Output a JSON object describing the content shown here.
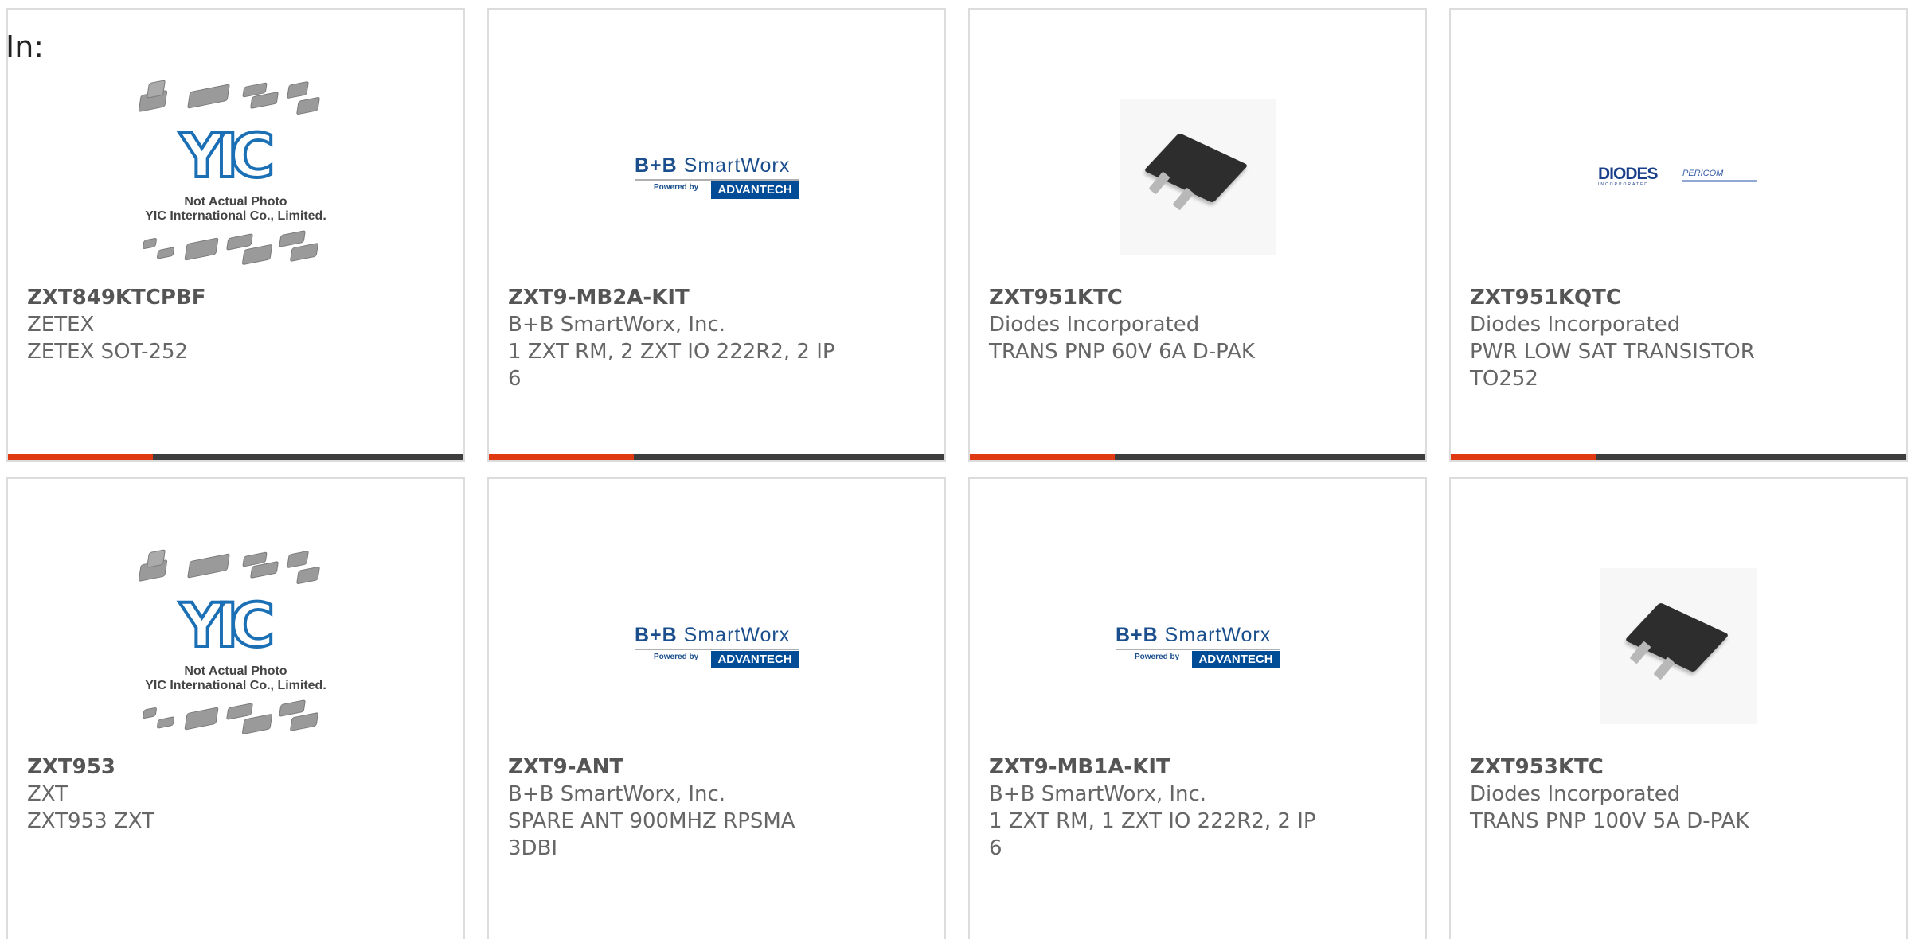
{
  "header": {
    "in_label": "In:"
  },
  "products": [
    {
      "part": "ZXT849KTCPBF",
      "maker": "ZETEX",
      "description": "ZETEX SOT-252",
      "image": "yic-placeholder-image"
    },
    {
      "part": "ZXT9-MB2A-KIT",
      "maker": "B+B SmartWorx, Inc.",
      "description": "1 ZXT RM, 2 ZXT IO 222R2, 2 IP 6",
      "image": "bb-smartworx-logo"
    },
    {
      "part": "ZXT951KTC",
      "maker": "Diodes Incorporated",
      "description": "TRANS PNP 60V 6A D-PAK",
      "image": "transistor-photo"
    },
    {
      "part": "ZXT951KQTC",
      "maker": "Diodes Incorporated",
      "description": "PWR LOW SAT TRANSISTOR TO252",
      "image": "diodes-pericom-logo"
    },
    {
      "part": "ZXT953",
      "maker": "ZXT",
      "description": "ZXT953 ZXT",
      "image": "yic-placeholder-image"
    },
    {
      "part": "ZXT9-ANT",
      "maker": "B+B SmartWorx, Inc.",
      "description": "SPARE ANT 900MHZ RPSMA 3DBI",
      "image": "bb-smartworx-logo"
    },
    {
      "part": "ZXT9-MB1A-KIT",
      "maker": "B+B SmartWorx, Inc.",
      "description": "1 ZXT RM, 1 ZXT IO 222R2, 2 IP 6",
      "image": "bb-smartworx-logo"
    },
    {
      "part": "ZXT953KTC",
      "maker": "Diodes Incorporated",
      "description": "TRANS PNP 100V 5A D-PAK",
      "image": "transistor-photo"
    }
  ],
  "logos": {
    "yic_mark": "YIC",
    "yic_line1": "Not Actual Photo",
    "yic_line2": "YIC International Co., Limited.",
    "bb_top_bold": "B+B",
    "bb_top": "SmartWorx",
    "bb_powered": "Powered by",
    "bb_advantech": "ADVANTECH",
    "diodes": "DIODES",
    "diodes_sub": "INCORPORATED",
    "pericom": "PERICOM"
  },
  "colors": {
    "accent_bar": "#e03a12",
    "bar": "#3d3d3d",
    "border": "#dcdcdc"
  }
}
